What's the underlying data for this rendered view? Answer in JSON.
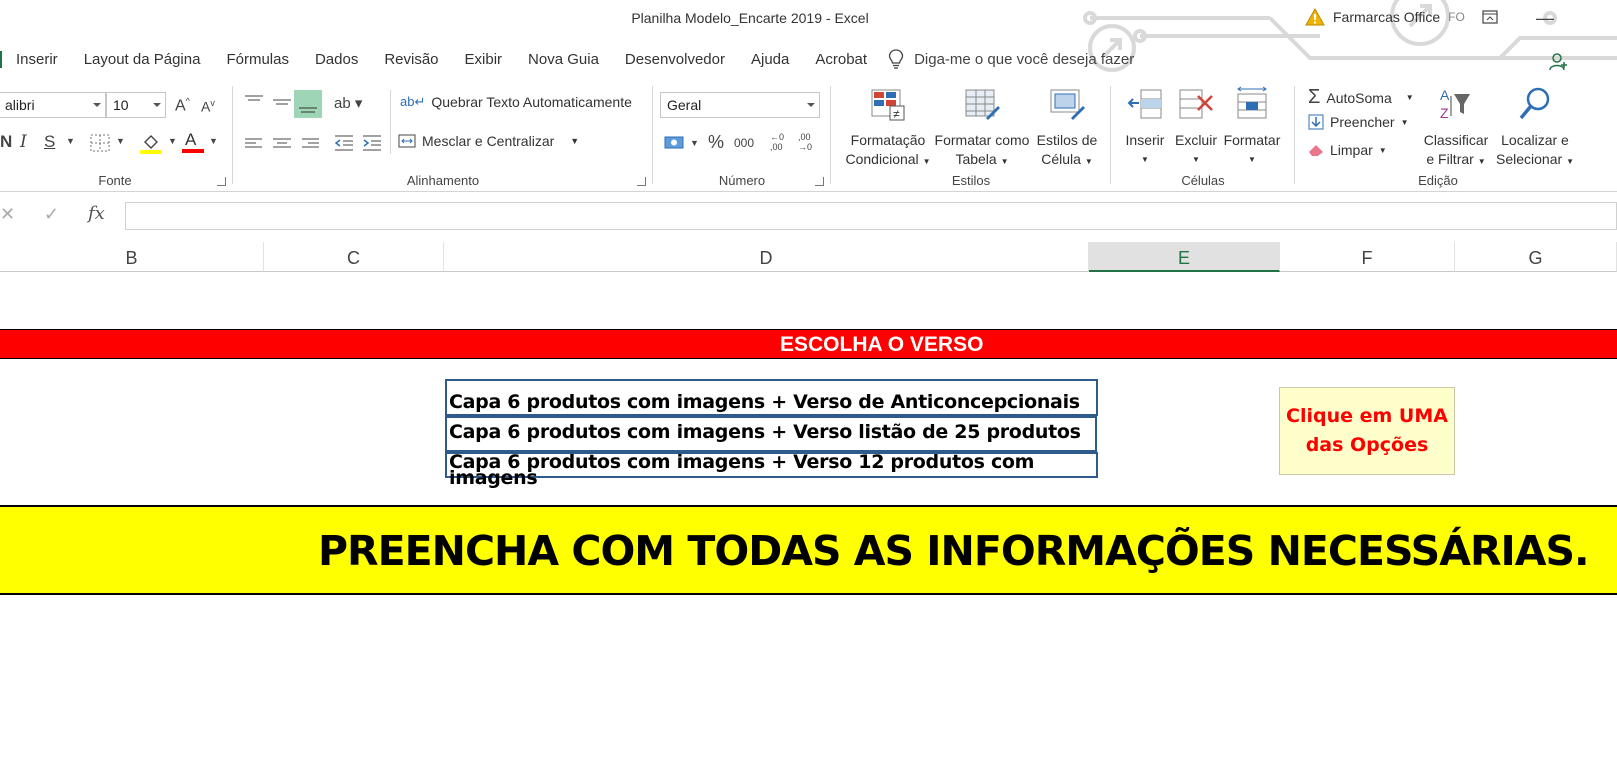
{
  "window": {
    "title": "Planilha Modelo_Encarte 2019  -  Excel",
    "user_name": "Farmarcas Office",
    "user_initials": "FO"
  },
  "tabs": [
    {
      "label": "Inserir"
    },
    {
      "label": "Layout da Página"
    },
    {
      "label": "Fórmulas"
    },
    {
      "label": "Dados"
    },
    {
      "label": "Revisão"
    },
    {
      "label": "Exibir"
    },
    {
      "label": "Nova Guia"
    },
    {
      "label": "Desenvolvedor"
    },
    {
      "label": "Ajuda"
    },
    {
      "label": "Acrobat"
    }
  ],
  "tell_me": "Diga-me o que você deseja fazer",
  "ribbon": {
    "fonte": {
      "label": "Fonte",
      "font_name": "alibri",
      "font_size": "10",
      "bold": "N",
      "italic": "I",
      "strike": "S"
    },
    "alinhamento": {
      "label": "Alinhamento",
      "wrap_text": "Quebrar Texto Automaticamente",
      "merge_center": "Mesclar e Centralizar"
    },
    "numero": {
      "label": "Número",
      "format": "Geral",
      "percent": "%",
      "thousands": "000",
      "inc_decimal": ",0 ,00",
      "dec_decimal": ",00 ,0"
    },
    "estilos": {
      "label": "Estilos",
      "cond_format_1": "Formatação",
      "cond_format_2": "Condicional",
      "table_format_1": "Formatar como",
      "table_format_2": "Tabela",
      "cell_styles_1": "Estilos de",
      "cell_styles_2": "Célula"
    },
    "celulas": {
      "label": "Células",
      "insert": "Inserir",
      "delete": "Excluir",
      "format": "Formatar"
    },
    "edicao": {
      "label": "Edição",
      "autosum": "AutoSoma",
      "fill": "Preencher",
      "clear": "Limpar",
      "sort_1": "Classificar",
      "sort_2": "e Filtrar",
      "find_1": "Localizar e",
      "find_2": "Selecionar"
    }
  },
  "formula_bar": {
    "fx": "fx",
    "value": ""
  },
  "columns": [
    "B",
    "C",
    "D",
    "E",
    "F",
    "G"
  ],
  "selected_column": "E",
  "sheet": {
    "header_red": "ESCOLHA O VERSO",
    "options": [
      "Capa 6 produtos com imagens + Verso de Anticoncepcionais",
      "Capa 6 produtos com imagens + Verso listão de 25 produtos",
      "Capa 6 produtos com imagens + Verso 12 produtos com imagens"
    ],
    "hint_line1": "Clique em UMA",
    "hint_line2": "das Opções",
    "banner": "PREENCHA COM TODAS AS INFORMAÇÕES NECESSÁRIAS."
  },
  "colors": {
    "excel_green": "#217346",
    "red_bar": "#ff0000",
    "yellow_bar": "#ffff00",
    "option_border": "#2f5b8c",
    "hint_bg": "#ffffcc"
  }
}
